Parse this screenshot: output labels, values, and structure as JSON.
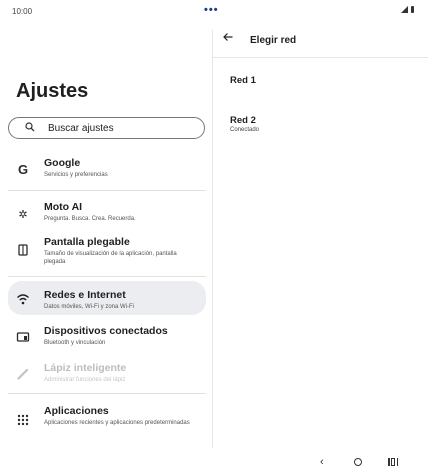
{
  "status_bar": {
    "time": "10:00",
    "dots": "•••"
  },
  "settings": {
    "title": "Ajustes",
    "search_placeholder": "Buscar ajustes",
    "items": [
      {
        "id": "google",
        "icon": "google-icon",
        "title": "Google",
        "subtitle": "Servicios y preferencias"
      },
      {
        "id": "moto-ai",
        "icon": "moto-ai-icon",
        "title": "Moto AI",
        "subtitle": "Pregunta. Busca. Crea. Recuerda."
      },
      {
        "id": "pantalla-plegable",
        "icon": "foldable-icon",
        "title": "Pantalla plegable",
        "subtitle": "Tamaño de visualización de la aplicación, pantalla plegada"
      },
      {
        "id": "redes",
        "icon": "wifi-icon",
        "title": "Redes e Internet",
        "subtitle": "Datos móviles, Wi-Fi y zona Wi-Fi"
      },
      {
        "id": "dispositivos",
        "icon": "connected-devices-icon",
        "title": "Dispositivos conectados",
        "subtitle": "Bluetooth y vinculación"
      },
      {
        "id": "lapiz",
        "icon": "pen-icon",
        "title": "Lápiz inteligente",
        "subtitle": "Administrar funciones del lápiz"
      },
      {
        "id": "aplicaciones",
        "icon": "apps-grid-icon",
        "title": "Aplicaciones",
        "subtitle": "Aplicaciones recientes y aplicaciones predeterminadas"
      }
    ]
  },
  "network_pane": {
    "title": "Elegir red",
    "networks": [
      {
        "name": "Red 1",
        "status": ""
      },
      {
        "name": "Red 2",
        "status": "Conectado"
      }
    ]
  },
  "colors": {
    "selected_bg": "#ecedf0",
    "accent_dots": "#1d3a8a"
  }
}
